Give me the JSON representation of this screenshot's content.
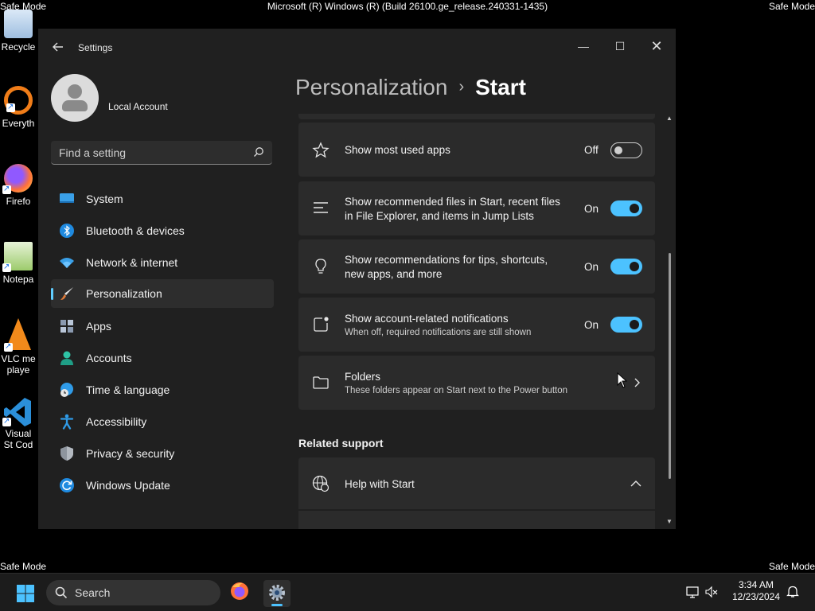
{
  "desktop": {
    "safe_mode_label": "Safe Mode",
    "build_text": "Microsoft (R) Windows (R) (Build 26100.ge_release.240331-1435)",
    "icons": [
      {
        "label": "Recycle",
        "icon": "recycle-bin-icon"
      },
      {
        "label": "Everyth",
        "icon": "everything-icon"
      },
      {
        "label": "Firefo",
        "icon": "firefox-icon"
      },
      {
        "label": "Notepa",
        "icon": "notepad-icon"
      },
      {
        "label": "VLC me playe",
        "icon": "vlc-icon"
      },
      {
        "label": "Visual St Cod",
        "icon": "vscode-icon"
      }
    ]
  },
  "window": {
    "app_title": "Settings",
    "controls": {
      "minimize": "—",
      "maximize": "☐",
      "close": "✕"
    }
  },
  "sidebar": {
    "account_name": "Local Account",
    "search_placeholder": "Find a setting",
    "items": [
      {
        "label": "System",
        "icon": "system-icon"
      },
      {
        "label": "Bluetooth & devices",
        "icon": "bluetooth-icon"
      },
      {
        "label": "Network & internet",
        "icon": "wifi-icon"
      },
      {
        "label": "Personalization",
        "icon": "brush-icon",
        "active": true
      },
      {
        "label": "Apps",
        "icon": "apps-icon"
      },
      {
        "label": "Accounts",
        "icon": "accounts-icon"
      },
      {
        "label": "Time & language",
        "icon": "clock-globe-icon"
      },
      {
        "label": "Accessibility",
        "icon": "accessibility-icon"
      },
      {
        "label": "Privacy & security",
        "icon": "shield-icon"
      },
      {
        "label": "Windows Update",
        "icon": "update-icon"
      }
    ]
  },
  "main": {
    "breadcrumb_parent": "Personalization",
    "breadcrumb_sep": "›",
    "breadcrumb_current": "Start",
    "settings": [
      {
        "title": "Show most used apps",
        "state": "Off",
        "icon": "star-icon"
      },
      {
        "title_line1": "Show recommended files in Start, recent files",
        "title_line2": "in File Explorer, and items in Jump Lists",
        "state": "On",
        "icon": "list-icon"
      },
      {
        "title_line1": "Show recommendations for tips, shortcuts,",
        "title_line2": "new apps, and more",
        "state": "On",
        "icon": "lightbulb-icon"
      },
      {
        "title": "Show account-related notifications",
        "subtitle": "When off, required notifications are still shown",
        "state": "On",
        "icon": "notification-icon"
      },
      {
        "title": "Folders",
        "subtitle": "These folders appear on Start next to the Power button",
        "icon": "folder-icon"
      }
    ],
    "related_support_title": "Related support",
    "help_item": "Help with Start"
  },
  "taskbar": {
    "search_label": "Search",
    "time": "3:34 AM",
    "date": "12/23/2024"
  },
  "colors": {
    "accent": "#4cc2ff",
    "window_bg": "#202020",
    "card_bg": "#2b2b2b"
  }
}
